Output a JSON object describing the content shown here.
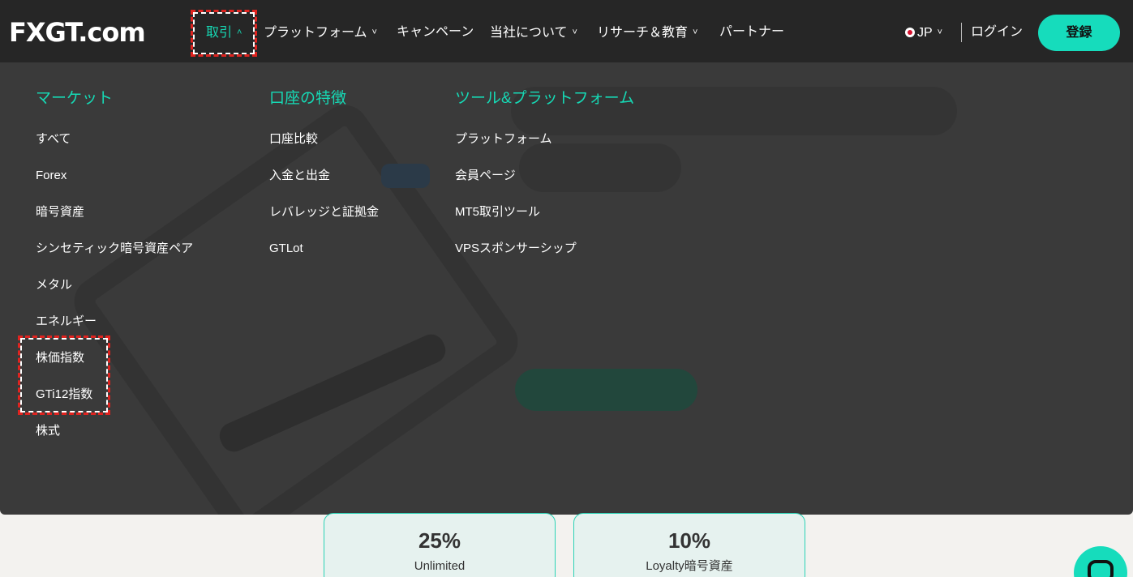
{
  "header": {
    "logo": {
      "part1": "FX",
      "part2": "GT",
      "part3": ".com"
    },
    "nav": [
      {
        "label": "取引",
        "chevron": "chevron-up-icon",
        "active": true
      },
      {
        "label": "プラットフォーム",
        "chevron": "chevron-down-icon"
      },
      {
        "label": "キャンペーン"
      },
      {
        "label": "当社について",
        "chevron": "chevron-down-icon"
      },
      {
        "label": "リサーチ＆教育",
        "chevron": "chevron-down-icon"
      },
      {
        "label": "パートナー"
      }
    ],
    "language": "JP",
    "login": "ログイン",
    "signup": "登録"
  },
  "mega_menu": {
    "columns": [
      {
        "heading": "マーケット",
        "items": [
          "すべて",
          "Forex",
          "暗号資産",
          "シンセティック暗号資産ペア",
          "メタル",
          "エネルギー",
          "株価指数",
          "GTi12指数",
          "株式"
        ]
      },
      {
        "heading": "口座の特徴",
        "items": [
          "口座比較",
          "入金と出金",
          "レバレッジと証拠金",
          "GTLot"
        ]
      },
      {
        "heading": "ツール&プラットフォーム",
        "items": [
          "プラットフォーム",
          "会員ページ",
          "MT5取引ツール",
          "VPSスポンサーシップ"
        ]
      }
    ]
  },
  "cards": [
    {
      "value": "25%",
      "label": "Unlimited"
    },
    {
      "value": "10%",
      "label": "Loyalty暗号資産"
    }
  ],
  "colors": {
    "accent": "#16d9b5",
    "header_bg": "#262626",
    "menu_bg": "#3a3a3a",
    "highlight_box": "#e0231f"
  },
  "icons": {
    "language_flag": "japan-flag-icon",
    "language_chevron": "chevron-down-icon",
    "chat": "chat-icon"
  }
}
